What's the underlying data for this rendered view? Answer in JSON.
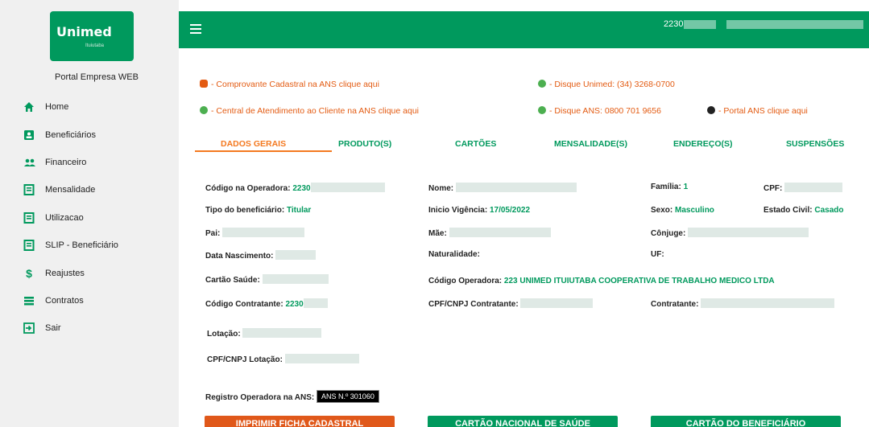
{
  "sidebar": {
    "logo_text": "Unimed",
    "logo_sub": "Ituiutaba",
    "portal_label": "Portal Empresa WEB",
    "items": [
      {
        "label": "Home"
      },
      {
        "label": "Beneficiários"
      },
      {
        "label": "Financeiro"
      },
      {
        "label": "Mensalidade"
      },
      {
        "label": "Utilizacao"
      },
      {
        "label": "SLIP - Beneficiário"
      },
      {
        "label": "Reajustes"
      },
      {
        "label": "Contratos"
      },
      {
        "label": "Sair"
      }
    ]
  },
  "header": {
    "code": "2230"
  },
  "links": {
    "comprovante": "- Comprovante Cadastral na ANS clique aqui",
    "disque_unimed": "- Disque Unimed: (34) 3268-0700",
    "central": "- Central de Atendimento ao Cliente na ANS clique aqui",
    "disque_ans": "- Disque ANS: 0800 701 9656",
    "portal_ans": "- Portal ANS clique aqui"
  },
  "tabs": [
    {
      "label": "DADOS GERAIS"
    },
    {
      "label": "PRODUTO(S)"
    },
    {
      "label": "CARTÕES"
    },
    {
      "label": "MENSALIDADE(S)"
    },
    {
      "label": "ENDEREÇO(S)"
    },
    {
      "label": "SUSPENSÕES"
    }
  ],
  "fields": {
    "codigo_operadora_label": "Código na Operadora:",
    "codigo_operadora_value": "2230",
    "nome_label": "Nome:",
    "familia_label": "Família:",
    "familia_value": "1",
    "cpf_label": "CPF:",
    "tipo_label": "Tipo do beneficiário:",
    "tipo_value": "Titular",
    "inicio_label": "Inicio Vigência:",
    "inicio_value": "17/05/2022",
    "sexo_label": "Sexo:",
    "sexo_value": "Masculino",
    "estado_civil_label": "Estado Civil:",
    "estado_civil_value": "Casado",
    "pai_label": "Pai:",
    "mae_label": "Mãe:",
    "conjuge_label": "Cônjuge:",
    "nascimento_label": "Data Nascimento:",
    "naturalidade_label": "Naturalidade:",
    "uf_label": "UF:",
    "cartao_label": "Cartão Saúde:",
    "codigo_op2_label": "Código Operadora:",
    "codigo_op2_value": "223 UNIMED ITUIUTABA COOPERATIVA DE TRABALHO MEDICO LTDA",
    "contratante_cod_label": "Código Contratante:",
    "contratante_cod_value": "2230",
    "cpf_contratante_label": "CPF/CNPJ Contratante:",
    "contratante_label": "Contratante:",
    "lotacao_label": "Lotação:",
    "cpf_lotacao_label": "CPF/CNPJ Lotação:",
    "registro_label": "Registro Operadora na ANS:",
    "ans_badge": "ANS N.º 301060"
  },
  "buttons": {
    "imprimir": "IMPRIMIR FICHA CADASTRAL",
    "cartao_nacional": "CARTÃO NACIONAL DE SAÚDE",
    "cartao_beneficiario": "CARTÃO DO BENEFICIÁRIO"
  },
  "colors": {
    "brand_green": "#00995d",
    "accent_orange": "#f47920",
    "link_orange": "#e35b12"
  }
}
